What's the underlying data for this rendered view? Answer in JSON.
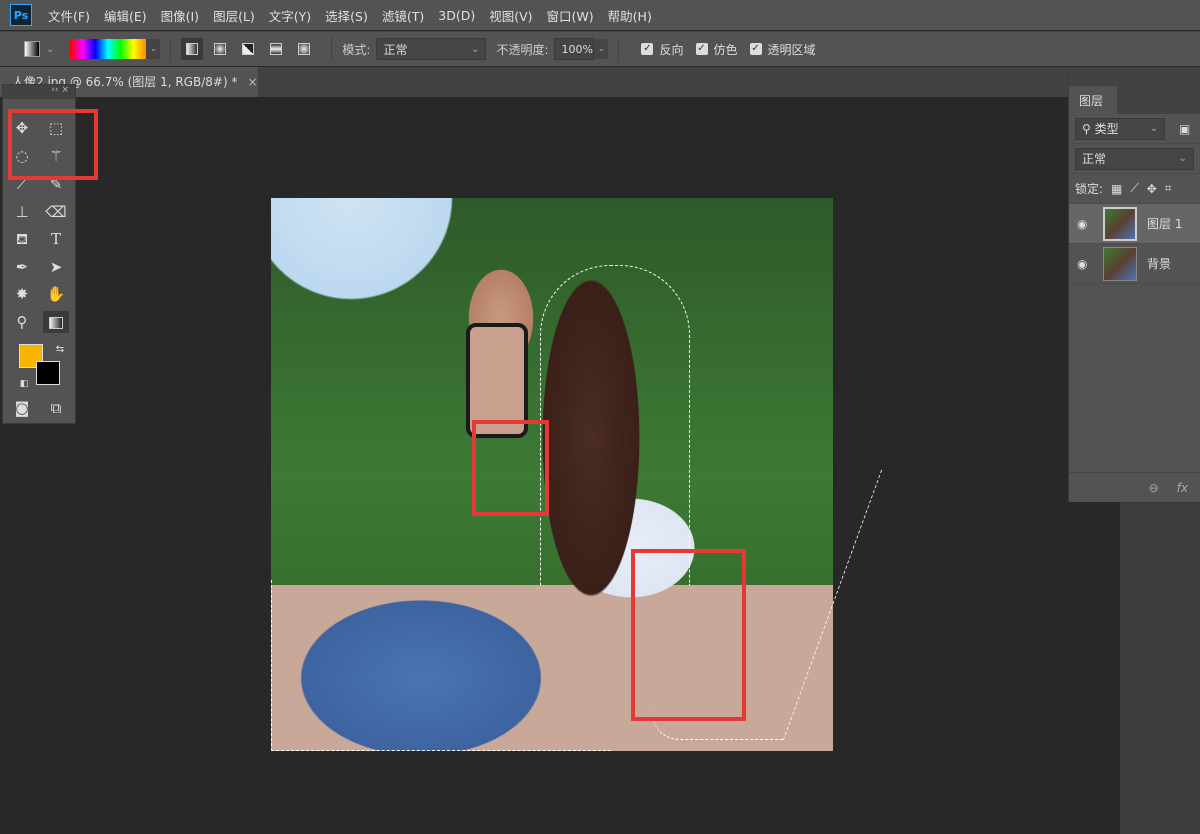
{
  "menubar": {
    "logo": "Ps",
    "items": [
      "文件(F)",
      "编辑(E)",
      "图像(I)",
      "图层(L)",
      "文字(Y)",
      "选择(S)",
      "滤镜(T)",
      "3D(D)",
      "视图(V)",
      "窗口(W)",
      "帮助(H)"
    ]
  },
  "options": {
    "mode_label": "模式:",
    "mode_value": "正常",
    "opacity_label": "不透明度:",
    "opacity_value": "100%",
    "checkboxes": [
      {
        "label": "反向",
        "checked": true
      },
      {
        "label": "仿色",
        "checked": true
      },
      {
        "label": "透明区域",
        "checked": true
      }
    ]
  },
  "document_tab": {
    "title": "人像2.jpg @ 66.7% (图层 1, RGB/8#) *",
    "close": "×"
  },
  "toolbox": {
    "collapse": "‹‹",
    "close": "×",
    "foreground_color": "#f8b500",
    "background_color": "#000000"
  },
  "layers_panel": {
    "tab": "图层",
    "filter_value": "类型",
    "blend_mode": "正常",
    "lock_label": "锁定:",
    "layers": [
      {
        "name": "图层 1",
        "visible": true,
        "selected": true
      },
      {
        "name": "背景",
        "visible": true,
        "selected": false
      }
    ],
    "footer_link": "⊖",
    "footer_fx": "fx"
  },
  "highlight_color": "#e53935"
}
